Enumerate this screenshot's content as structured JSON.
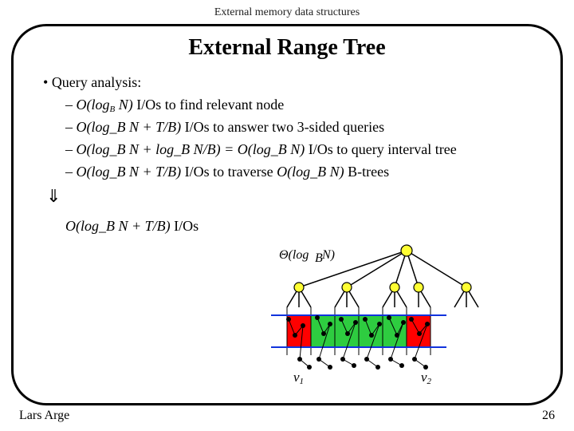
{
  "course_title": "External memory data structures",
  "slide_title": "External Range Tree",
  "bullets": {
    "main": "Query analysis:",
    "line1_pre": "O(log",
    "line1_sub": "B",
    "line1_post": " N)",
    "line1_txt": " I/Os to find relevant node",
    "line2_math": "O(log_B N + T/B)",
    "line2_txt": " I/Os to answer two 3-sided queries",
    "line3_math": "O(log_B N + log_B N/B) = O(log_B N)",
    "line3_txt": " I/Os to query interval tree",
    "line4_math": "O(log_B N + T/B)",
    "line4_mid": " I/Os to traverse ",
    "line4_math2": "O(log_B N)",
    "line4_txt": " B-trees",
    "arrow": "⇓",
    "final_math": "O(log_B N + T/B)",
    "final_txt": " I/Os"
  },
  "figure": {
    "theta_label": "Θ(log_B N)",
    "v1": "v",
    "v1sub": "1",
    "v2": "v",
    "v2sub": "2"
  },
  "footer": {
    "author": "Lars Arge",
    "page": "26"
  }
}
